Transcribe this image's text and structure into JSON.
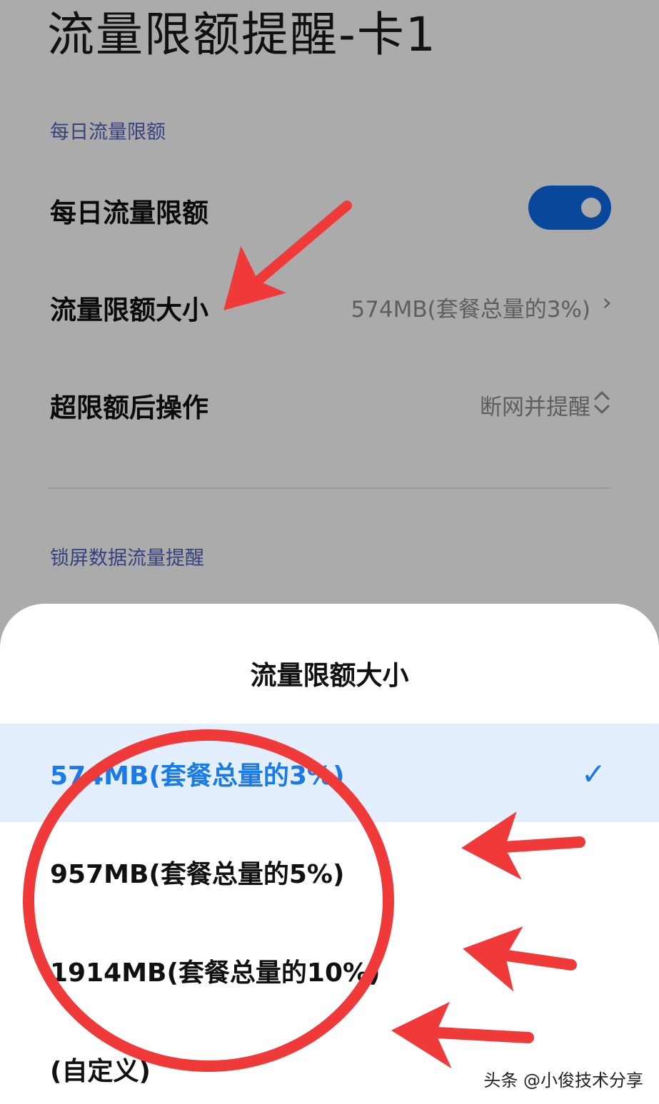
{
  "page": {
    "title": "流量限额提醒-卡1",
    "section_daily": "每日流量限额",
    "rows": {
      "daily_limit": {
        "label": "每日流量限额",
        "toggle_on": true
      },
      "limit_size": {
        "label": "流量限额大小",
        "value": "574MB(套餐总量的3%)",
        "chevron": "›"
      },
      "after_limit": {
        "label": "超限额后操作",
        "value": "断网并提醒",
        "chevron": "⌃⌄"
      }
    },
    "section_lockscreen": "锁屏数据流量提醒"
  },
  "sheet": {
    "title": "流量限额大小",
    "options": [
      {
        "label": "574MB(套餐总量的3%)",
        "selected": true
      },
      {
        "label": "957MB(套餐总量的5%)",
        "selected": false
      },
      {
        "label": "1914MB(套餐总量的10%)",
        "selected": false
      },
      {
        "label": "(自定义)",
        "selected": false
      }
    ],
    "check_glyph": "✓"
  },
  "watermark": "头条 @小俊技术分享",
  "colors": {
    "accent": "#1a7ae8",
    "toggle": "#0c6be6",
    "selected_bg": "#e3effd",
    "annotation_red": "#f03a3a"
  }
}
